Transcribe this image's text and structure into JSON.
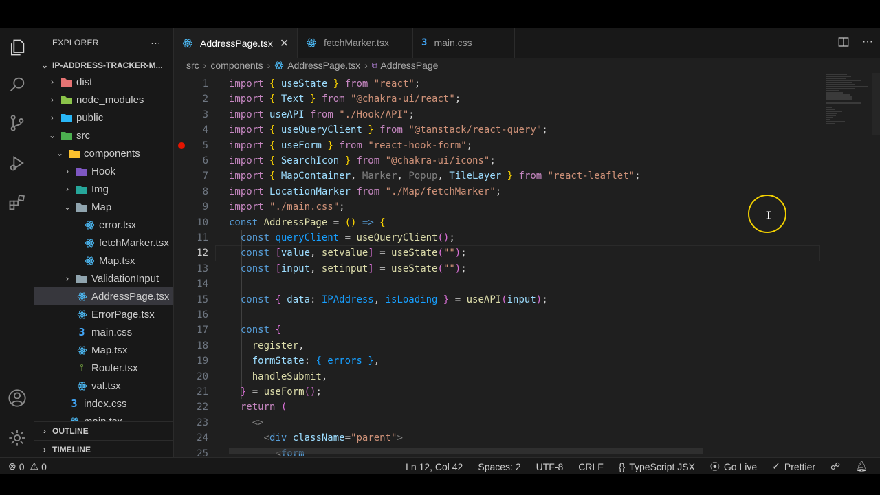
{
  "explorer": {
    "title": "EXPLORER",
    "more": "···",
    "project": "IP-ADDRESS-TRACKER-M...",
    "tree": [
      {
        "label": "dist",
        "depth": 1,
        "chev": "›",
        "icon": "folder-dist"
      },
      {
        "label": "node_modules",
        "depth": 1,
        "chev": "›",
        "icon": "folder-node"
      },
      {
        "label": "public",
        "depth": 1,
        "chev": "›",
        "icon": "folder-public"
      },
      {
        "label": "src",
        "depth": 1,
        "chev": "⌄",
        "icon": "folder-src"
      },
      {
        "label": "components",
        "depth": 2,
        "chev": "⌄",
        "icon": "folder-components"
      },
      {
        "label": "Hook",
        "depth": 3,
        "chev": "›",
        "icon": "folder-hook"
      },
      {
        "label": "Img",
        "depth": 3,
        "chev": "›",
        "icon": "folder-img"
      },
      {
        "label": "Map",
        "depth": 3,
        "chev": "⌄",
        "icon": "folder-map"
      },
      {
        "label": "error.tsx",
        "depth": 4,
        "chev": "",
        "icon": "react"
      },
      {
        "label": "fetchMarker.tsx",
        "depth": 4,
        "chev": "",
        "icon": "react"
      },
      {
        "label": "Map.tsx",
        "depth": 4,
        "chev": "",
        "icon": "react"
      },
      {
        "label": "ValidationInput",
        "depth": 3,
        "chev": "›",
        "icon": "folder"
      },
      {
        "label": "AddressPage.tsx",
        "depth": 3,
        "chev": "",
        "icon": "react",
        "active": true
      },
      {
        "label": "ErrorPage.tsx",
        "depth": 3,
        "chev": "",
        "icon": "react"
      },
      {
        "label": "main.css",
        "depth": 3,
        "chev": "",
        "icon": "css"
      },
      {
        "label": "Map.tsx",
        "depth": 3,
        "chev": "",
        "icon": "react"
      },
      {
        "label": "Router.tsx",
        "depth": 3,
        "chev": "",
        "icon": "router"
      },
      {
        "label": "val.tsx",
        "depth": 3,
        "chev": "",
        "icon": "react"
      },
      {
        "label": "index.css",
        "depth": 2,
        "chev": "",
        "icon": "css"
      },
      {
        "label": "main.tsx",
        "depth": 2,
        "chev": "",
        "icon": "react"
      }
    ],
    "outline": "OUTLINE",
    "timeline": "TIMELINE"
  },
  "tabs": [
    {
      "label": "AddressPage.tsx",
      "active": true,
      "icon": "react"
    },
    {
      "label": "fetchMarker.tsx",
      "active": false,
      "icon": "react"
    },
    {
      "label": "main.css",
      "active": false,
      "icon": "css"
    }
  ],
  "breadcrumb": [
    "src",
    "components",
    "AddressPage.tsx",
    "AddressPage"
  ],
  "code": {
    "current_line": 12,
    "breakpoint_line": 5,
    "lines": [
      [
        [
          "import ",
          "k"
        ],
        [
          "{ ",
          "y"
        ],
        [
          "useState ",
          "v"
        ],
        [
          "} ",
          "y"
        ],
        [
          "from ",
          "k"
        ],
        [
          "\"react\"",
          "s"
        ],
        [
          ";",
          "w"
        ]
      ],
      [
        [
          "import ",
          "k"
        ],
        [
          "{ ",
          "y"
        ],
        [
          "Text ",
          "v"
        ],
        [
          "} ",
          "y"
        ],
        [
          "from ",
          "k"
        ],
        [
          "\"@chakra-ui/react\"",
          "s"
        ],
        [
          ";",
          "w"
        ]
      ],
      [
        [
          "import ",
          "k"
        ],
        [
          "useAPI ",
          "v"
        ],
        [
          "from ",
          "k"
        ],
        [
          "\"./Hook/API\"",
          "s"
        ],
        [
          ";",
          "w"
        ]
      ],
      [
        [
          "import ",
          "k"
        ],
        [
          "{ ",
          "y"
        ],
        [
          "useQueryClient ",
          "v"
        ],
        [
          "} ",
          "y"
        ],
        [
          "from ",
          "k"
        ],
        [
          "\"@tanstack/react-query\"",
          "s"
        ],
        [
          ";",
          "w"
        ]
      ],
      [
        [
          "import ",
          "k"
        ],
        [
          "{ ",
          "y"
        ],
        [
          "useForm ",
          "v"
        ],
        [
          "} ",
          "y"
        ],
        [
          "from ",
          "k"
        ],
        [
          "\"react-hook-form\"",
          "s"
        ],
        [
          ";",
          "w"
        ]
      ],
      [
        [
          "import ",
          "k"
        ],
        [
          "{ ",
          "y"
        ],
        [
          "SearchIcon ",
          "v"
        ],
        [
          "} ",
          "y"
        ],
        [
          "from ",
          "k"
        ],
        [
          "\"@chakra-ui/icons\"",
          "s"
        ],
        [
          ";",
          "w"
        ]
      ],
      [
        [
          "import ",
          "k"
        ],
        [
          "{ ",
          "y"
        ],
        [
          "MapContainer",
          "v"
        ],
        [
          ", ",
          "w"
        ],
        [
          "Marker",
          "g"
        ],
        [
          ", ",
          "w"
        ],
        [
          "Popup",
          "g"
        ],
        [
          ", ",
          "w"
        ],
        [
          "TileLayer ",
          "v"
        ],
        [
          "} ",
          "y"
        ],
        [
          "from ",
          "k"
        ],
        [
          "\"react-leaflet\"",
          "s"
        ],
        [
          ";",
          "w"
        ]
      ],
      [
        [
          "import ",
          "k"
        ],
        [
          "LocationMarker ",
          "v"
        ],
        [
          "from ",
          "k"
        ],
        [
          "\"./Map/fetchMarker\"",
          "s"
        ],
        [
          ";",
          "w"
        ]
      ],
      [
        [
          "import ",
          "k"
        ],
        [
          "\"./main.css\"",
          "s"
        ],
        [
          ";",
          "w"
        ]
      ],
      [
        [
          "const ",
          "b"
        ],
        [
          "AddressPage ",
          "f"
        ],
        [
          "= ",
          "w"
        ],
        [
          "() ",
          "y"
        ],
        [
          "=> ",
          "b"
        ],
        [
          "{",
          "y"
        ]
      ],
      [
        [
          "  ",
          "w"
        ],
        [
          "const ",
          "b"
        ],
        [
          "queryClient ",
          "c2"
        ],
        [
          "= ",
          "w"
        ],
        [
          "useQueryClient",
          "f"
        ],
        [
          "()",
          "p"
        ],
        [
          ";",
          "w"
        ]
      ],
      [
        [
          "  ",
          "w"
        ],
        [
          "const ",
          "b"
        ],
        [
          "[",
          "p"
        ],
        [
          "value",
          "v"
        ],
        [
          ", ",
          "w"
        ],
        [
          "setvalue",
          "f"
        ],
        [
          "] ",
          "p"
        ],
        [
          "= ",
          "w"
        ],
        [
          "useState",
          "f"
        ],
        [
          "(",
          "p"
        ],
        [
          "\"\"",
          "s"
        ],
        [
          ")",
          "p"
        ],
        [
          ";",
          "w"
        ]
      ],
      [
        [
          "  ",
          "w"
        ],
        [
          "const ",
          "b"
        ],
        [
          "[",
          "p"
        ],
        [
          "input",
          "v"
        ],
        [
          ", ",
          "w"
        ],
        [
          "setinput",
          "f"
        ],
        [
          "] ",
          "p"
        ],
        [
          "= ",
          "w"
        ],
        [
          "useState",
          "f"
        ],
        [
          "(",
          "p"
        ],
        [
          "\"\"",
          "s"
        ],
        [
          ")",
          "p"
        ],
        [
          ";",
          "w"
        ]
      ],
      [],
      [
        [
          "  ",
          "w"
        ],
        [
          "const ",
          "b"
        ],
        [
          "{ ",
          "p"
        ],
        [
          "data",
          "v"
        ],
        [
          ": ",
          "w"
        ],
        [
          "IPAddress",
          "c2"
        ],
        [
          ", ",
          "w"
        ],
        [
          "isLoading ",
          "c2"
        ],
        [
          "} ",
          "p"
        ],
        [
          "= ",
          "w"
        ],
        [
          "useAPI",
          "f"
        ],
        [
          "(",
          "p"
        ],
        [
          "input",
          "v"
        ],
        [
          ")",
          "p"
        ],
        [
          ";",
          "w"
        ]
      ],
      [],
      [
        [
          "  ",
          "w"
        ],
        [
          "const ",
          "b"
        ],
        [
          "{",
          "p"
        ]
      ],
      [
        [
          "    ",
          "w"
        ],
        [
          "register",
          "f"
        ],
        [
          ",",
          "w"
        ]
      ],
      [
        [
          "    ",
          "w"
        ],
        [
          "formState",
          "v"
        ],
        [
          ": ",
          "w"
        ],
        [
          "{ ",
          "c2"
        ],
        [
          "errors ",
          "c2"
        ],
        [
          "}",
          "c2"
        ],
        [
          ",",
          "w"
        ]
      ],
      [
        [
          "    ",
          "w"
        ],
        [
          "handleSubmit",
          "f"
        ],
        [
          ",",
          "w"
        ]
      ],
      [
        [
          "  ",
          "w"
        ],
        [
          "} ",
          "p"
        ],
        [
          "= ",
          "w"
        ],
        [
          "useForm",
          "f"
        ],
        [
          "()",
          "p"
        ],
        [
          ";",
          "w"
        ]
      ],
      [
        [
          "  ",
          "w"
        ],
        [
          "return ",
          "k"
        ],
        [
          "(",
          "p"
        ]
      ],
      [
        [
          "    ",
          "w"
        ],
        [
          "<>",
          "g"
        ]
      ],
      [
        [
          "      ",
          "w"
        ],
        [
          "<",
          "g"
        ],
        [
          "div ",
          "b"
        ],
        [
          "className",
          "v"
        ],
        [
          "=",
          "w"
        ],
        [
          "\"parent\"",
          "s"
        ],
        [
          ">",
          "g"
        ]
      ],
      [
        [
          "        ",
          "w"
        ],
        [
          "<",
          "g"
        ],
        [
          "form",
          "b"
        ]
      ]
    ]
  },
  "status": {
    "errors": "0",
    "warnings": "0",
    "position": "Ln 12, Col 42",
    "spaces": "Spaces: 2",
    "encoding": "UTF-8",
    "eol": "CRLF",
    "language": "TypeScript JSX",
    "golive": "Go Live",
    "prettier": "Prettier"
  },
  "colors": {
    "accent": "#0078d4",
    "react": "#4fc1ff",
    "css": "#42a5f5",
    "folder": "#90a4ae",
    "breakpoint": "#e51400"
  }
}
